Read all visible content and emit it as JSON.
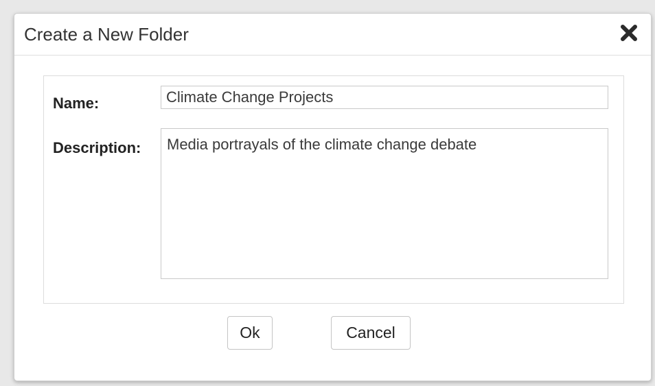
{
  "dialog": {
    "title": "Create a New Folder",
    "close_icon": "close-icon"
  },
  "form": {
    "name_label": "Name:",
    "name_value": "Climate Change Projects",
    "description_label": "Description:",
    "description_value": "Media portrayals of the climate change debate"
  },
  "buttons": {
    "ok_label": "Ok",
    "cancel_label": "Cancel"
  },
  "colors": {
    "backdrop": "#e8e8e8",
    "dialog_bg": "#ffffff",
    "text": "#333333",
    "border": "#c9c9c9"
  }
}
